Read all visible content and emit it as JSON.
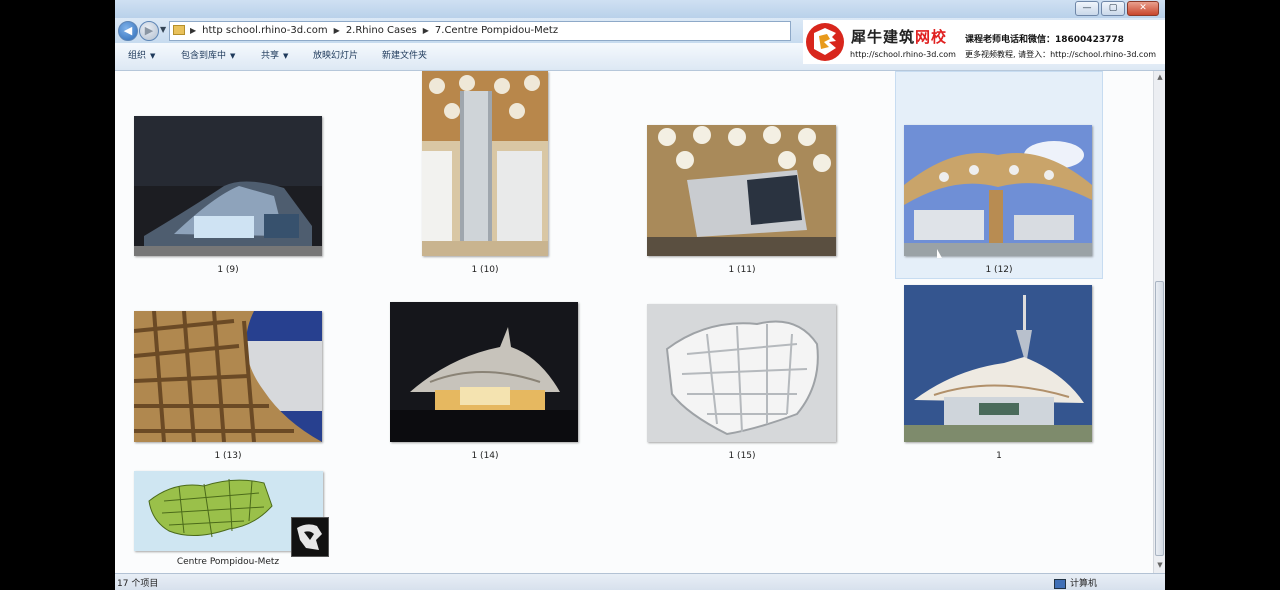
{
  "window": {
    "controls": {
      "minimize": "—",
      "maximize": "▢",
      "close": "✕"
    }
  },
  "address": {
    "crumbs": [
      "http school.rhino-3d.com",
      "2.Rhino Cases",
      "7.Centre Pompidou-Metz"
    ]
  },
  "toolbar": {
    "organize": "组织",
    "include_in_library": "包含到库中",
    "share": "共享",
    "slideshow": "放映幻灯片",
    "new_folder": "新建文件夹"
  },
  "banner": {
    "title_black": "犀牛建筑",
    "title_red": "网校",
    "url": "http://school.rhino-3d.com",
    "line1": "课程老师电话和微信：18600423778",
    "line2": "更多视频教程, 请登入：http://school.rhino-3d.com"
  },
  "files": [
    {
      "name": "1 (9)"
    },
    {
      "name": "1 (10)"
    },
    {
      "name": "1 (11)"
    },
    {
      "name": "1 (12)"
    },
    {
      "name": "1 (13)"
    },
    {
      "name": "1 (14)"
    },
    {
      "name": "1 (15)"
    },
    {
      "name": "1"
    },
    {
      "name": "Centre Pompidou-Metz"
    }
  ],
  "status": {
    "item_count": "17 个项目",
    "location": "计算机"
  }
}
